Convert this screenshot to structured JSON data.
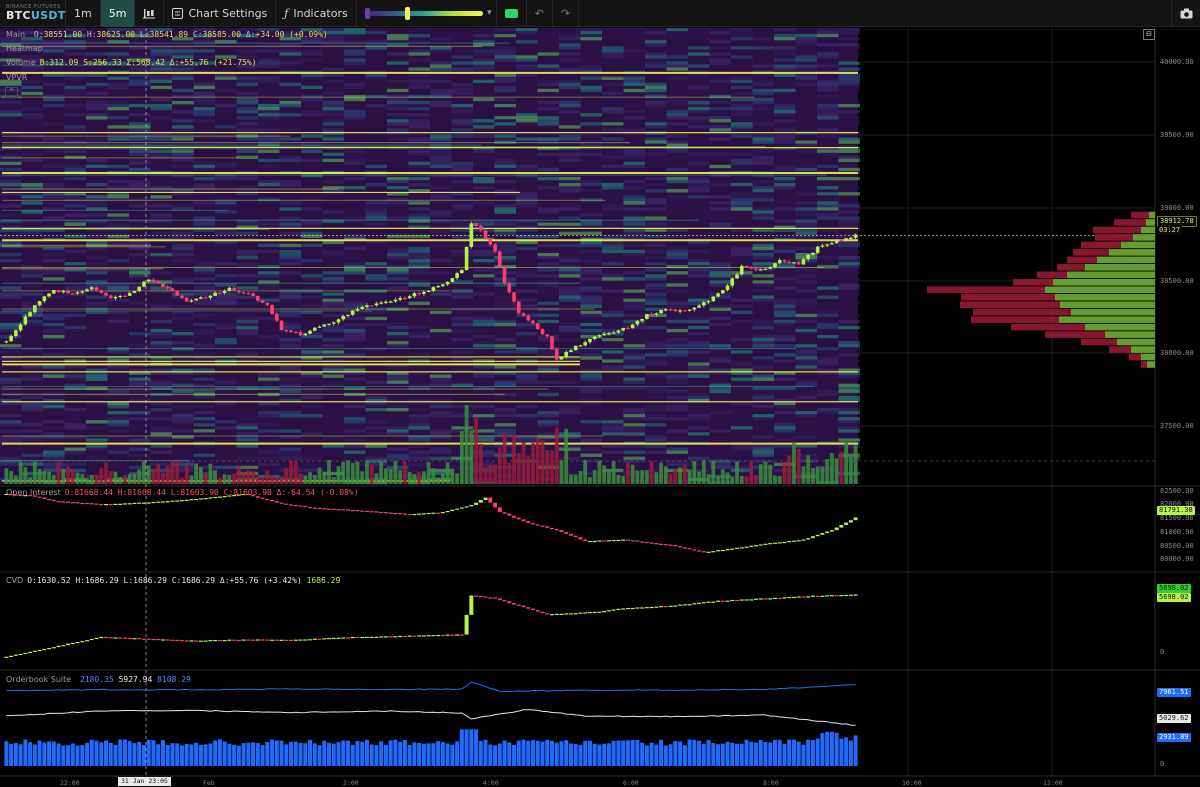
{
  "toolbar": {
    "exchange": "BINANCE FUTURES",
    "symbol_base": "BTC",
    "symbol_quote": "USDT",
    "timeframes": [
      "1m",
      "5m"
    ],
    "active_timeframe": "5m",
    "chart_settings": "Chart Settings",
    "indicators": "Indicators"
  },
  "main_panel": {
    "name": "Main",
    "o": "38551.00",
    "h": "38625.00",
    "l": "38541.89",
    "c": "38585.00",
    "delta": "+34.00 (+0.09%)",
    "heatmap_label": "Heatmap",
    "volume_label": "Volume",
    "volume_values": "B:312.09 S:256.33 Σ:568.42 Δ:+55.76 (+21.75%)",
    "vpvr_label": "VPVR",
    "price_ticks": [
      "40000.00",
      "39500.00",
      "39000.00",
      "38500.00",
      "38000.00",
      "37500.00"
    ],
    "last_price": "38912.78",
    "countdown": "03:27"
  },
  "oi_panel": {
    "name": "Open Interest",
    "values": "O:81668.44 H:81668.44 L:81603.90 C:81603.90 Δ:-64.54 (-0.08%)",
    "ticks": [
      "82500.00",
      "82000.00",
      "81500.00",
      "81000.00",
      "80500.00",
      "80000.00"
    ],
    "last": "81791.38"
  },
  "cvd_panel": {
    "name": "CVD",
    "values": "O:1630.52 H:1686.29 L:1686.29 C:1686.29 Δ:+55.76 (+3.42%)",
    "last_value": "1686.29",
    "ticks": [
      "0"
    ],
    "chip_top": "5698.02",
    "chip_bottom": "5698.02"
  },
  "ob_panel": {
    "name": "Orderbook Suite",
    "v1": "2180.35",
    "v2": "5927.94",
    "v3": "8108.29",
    "chip_blue": "7961.51",
    "chip_white": "5029.62",
    "chip_bars": "2931.89",
    "ticks": [
      "0"
    ]
  },
  "time_axis": {
    "labels": [
      "22:00",
      "Feb",
      "2:00",
      "4:00",
      "6:00",
      "8:00",
      "10:00",
      "12:00"
    ],
    "crosshair": "31 Jan 23:05"
  },
  "colors": {
    "up": "#b7f24a",
    "down": "#ff3d6e",
    "heat_bg": "#2a1142",
    "level": "#f6f24e",
    "vp_buy": "#6aa534",
    "vp_sell": "#8e1830",
    "ob_blue": "#1f6bff",
    "ob_white": "#e6e6e6"
  },
  "chart_data": [
    {
      "type": "candlestick",
      "name": "Main",
      "time_range": [
        "21:00",
        "13:00"
      ],
      "price_range": [
        37250,
        40300
      ],
      "close_path": [
        [
          0,
          38200
        ],
        [
          6,
          38450
        ],
        [
          10,
          38550
        ],
        [
          14,
          38520
        ],
        [
          18,
          38560
        ],
        [
          22,
          38500
        ],
        [
          26,
          38520
        ],
        [
          30,
          38620
        ],
        [
          34,
          38560
        ],
        [
          38,
          38470
        ],
        [
          42,
          38500
        ],
        [
          47,
          38560
        ],
        [
          51,
          38520
        ],
        [
          55,
          38450
        ],
        [
          58,
          38280
        ],
        [
          62,
          38250
        ],
        [
          66,
          38300
        ],
        [
          70,
          38350
        ],
        [
          74,
          38420
        ],
        [
          78,
          38460
        ],
        [
          82,
          38480
        ],
        [
          86,
          38520
        ],
        [
          90,
          38560
        ],
        [
          93,
          38600
        ],
        [
          96,
          38680
        ],
        [
          98,
          39000
        ],
        [
          100,
          38950
        ],
        [
          103,
          38800
        ],
        [
          105,
          38600
        ],
        [
          108,
          38400
        ],
        [
          111,
          38320
        ],
        [
          114,
          38230
        ],
        [
          116,
          38080
        ],
        [
          119,
          38150
        ],
        [
          123,
          38220
        ],
        [
          127,
          38260
        ],
        [
          131,
          38300
        ],
        [
          135,
          38380
        ],
        [
          139,
          38420
        ],
        [
          143,
          38400
        ],
        [
          147,
          38460
        ],
        [
          151,
          38540
        ],
        [
          155,
          38700
        ],
        [
          159,
          38680
        ],
        [
          163,
          38740
        ],
        [
          167,
          38720
        ],
        [
          171,
          38830
        ],
        [
          175,
          38880
        ],
        [
          179,
          38912
        ]
      ],
      "levels": [
        40000,
        39600,
        39500,
        39330,
        39200,
        38960,
        38880,
        38100,
        38070,
        38050,
        38000,
        37800,
        37520,
        37270
      ],
      "volume_profile": [
        {
          "price": 39050,
          "buy": 6,
          "sell": 18
        },
        {
          "price": 39000,
          "buy": 9,
          "sell": 32
        },
        {
          "price": 38950,
          "buy": 14,
          "sell": 48
        },
        {
          "price": 38900,
          "buy": 22,
          "sell": 38
        },
        {
          "price": 38850,
          "buy": 34,
          "sell": 40
        },
        {
          "price": 38800,
          "buy": 46,
          "sell": 36
        },
        {
          "price": 38750,
          "buy": 58,
          "sell": 30
        },
        {
          "price": 38700,
          "buy": 70,
          "sell": 28
        },
        {
          "price": 38650,
          "buy": 88,
          "sell": 30
        },
        {
          "price": 38600,
          "buy": 102,
          "sell": 40
        },
        {
          "price": 38550,
          "buy": 110,
          "sell": 118
        },
        {
          "price": 38500,
          "buy": 100,
          "sell": 94
        },
        {
          "price": 38450,
          "buy": 95,
          "sell": 100
        },
        {
          "price": 38400,
          "buy": 84,
          "sell": 98
        },
        {
          "price": 38350,
          "buy": 96,
          "sell": 88
        },
        {
          "price": 38300,
          "buy": 70,
          "sell": 74
        },
        {
          "price": 38250,
          "buy": 50,
          "sell": 60
        },
        {
          "price": 38200,
          "buy": 38,
          "sell": 36
        },
        {
          "price": 38150,
          "buy": 24,
          "sell": 22
        },
        {
          "price": 38100,
          "buy": 14,
          "sell": 12
        },
        {
          "price": 38050,
          "buy": 8,
          "sell": 6
        }
      ]
    },
    {
      "type": "line",
      "name": "Open Interest",
      "y_range": [
        79800,
        82700
      ],
      "points": [
        [
          0,
          82550
        ],
        [
          5,
          82500
        ],
        [
          10,
          82300
        ],
        [
          20,
          82180
        ],
        [
          30,
          82250
        ],
        [
          40,
          82380
        ],
        [
          50,
          82560
        ],
        [
          58,
          82200
        ],
        [
          65,
          82050
        ],
        [
          75,
          81950
        ],
        [
          85,
          81820
        ],
        [
          92,
          81900
        ],
        [
          98,
          82150
        ],
        [
          101,
          82420
        ],
        [
          104,
          81900
        ],
        [
          110,
          81500
        ],
        [
          116,
          81250
        ],
        [
          122,
          80850
        ],
        [
          130,
          80900
        ],
        [
          140,
          80700
        ],
        [
          147,
          80450
        ],
        [
          152,
          80550
        ],
        [
          160,
          80750
        ],
        [
          168,
          80900
        ],
        [
          174,
          81250
        ],
        [
          179,
          81700
        ]
      ]
    },
    {
      "type": "line",
      "name": "CVD",
      "y_range": [
        -200,
        7200
      ],
      "points": [
        [
          0,
          700
        ],
        [
          10,
          1500
        ],
        [
          20,
          2300
        ],
        [
          30,
          2150
        ],
        [
          40,
          2000
        ],
        [
          50,
          2100
        ],
        [
          60,
          2050
        ],
        [
          70,
          2250
        ],
        [
          80,
          2350
        ],
        [
          90,
          2450
        ],
        [
          96,
          2500
        ],
        [
          98,
          5650
        ],
        [
          103,
          5400
        ],
        [
          108,
          4800
        ],
        [
          114,
          4100
        ],
        [
          118,
          4200
        ],
        [
          124,
          4300
        ],
        [
          130,
          4600
        ],
        [
          140,
          4800
        ],
        [
          150,
          5200
        ],
        [
          160,
          5400
        ],
        [
          170,
          5600
        ],
        [
          179,
          5700
        ]
      ]
    },
    {
      "type": "line",
      "name": "Orderbook Suite",
      "series": [
        {
          "name": "2180.35",
          "values": [
            [
              0,
              7550
            ],
            [
              20,
              7610
            ],
            [
              40,
              7600
            ],
            [
              60,
              7660
            ],
            [
              80,
              7620
            ],
            [
              96,
              7650
            ],
            [
              98,
              8150
            ],
            [
              104,
              7500
            ],
            [
              120,
              7560
            ],
            [
              140,
              7580
            ],
            [
              160,
              7630
            ],
            [
              179,
              7960
            ]
          ]
        },
        {
          "name": "5927.94",
          "values": [
            [
              0,
              5700
            ],
            [
              20,
              6080
            ],
            [
              40,
              6100
            ],
            [
              60,
              5960
            ],
            [
              80,
              6060
            ],
            [
              96,
              5920
            ],
            [
              98,
              5500
            ],
            [
              110,
              6180
            ],
            [
              122,
              5700
            ],
            [
              140,
              5660
            ],
            [
              160,
              5760
            ],
            [
              179,
              5030
            ]
          ]
        }
      ],
      "bars_range": [
        0,
        3000
      ]
    }
  ]
}
